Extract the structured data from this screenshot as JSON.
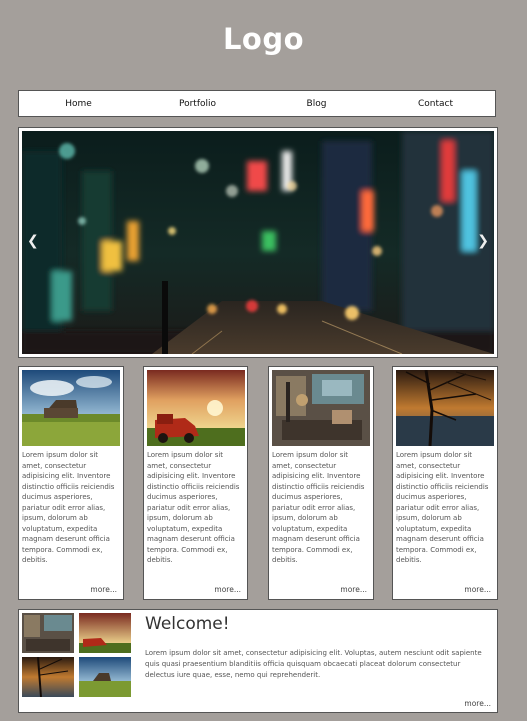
{
  "logo": "Logo",
  "nav": {
    "items": [
      "Home",
      "Portfolio",
      "Blog",
      "Contact"
    ]
  },
  "slider": {
    "prev_icon": "chevron-left-icon",
    "next_icon": "chevron-right-icon"
  },
  "cards": [
    {
      "text": "Lorem ipsum dolor sit amet, consectetur adipisicing elit. Inventore distinctio officiis reiciendis ducimus asperiores, pariatur odit error alias, ipsum, dolorum ab voluptatum, expedita magnam deserunt officia tempora. Commodi ex, debitis.",
      "more": "more..."
    },
    {
      "text": "Lorem ipsum dolor sit amet, consectetur adipisicing elit. Inventore distinctio officiis reiciendis ducimus asperiores, pariatur odit error alias, ipsum, dolorum ab voluptatum, expedita magnam deserunt officia tempora. Commodi ex, debitis.",
      "more": "more..."
    },
    {
      "text": "Lorem ipsum dolor sit amet, consectetur adipisicing elit. Inventore distinctio officiis reiciendis ducimus asperiores, pariatur odit error alias, ipsum, dolorum ab voluptatum, expedita magnam deserunt officia tempora. Commodi ex, debitis.",
      "more": "more..."
    },
    {
      "text": "Lorem ipsum dolor sit amet, consectetur adipisicing elit. Inventore distinctio officiis reiciendis ducimus asperiores, pariatur odit error alias, ipsum, dolorum ab voluptatum, expedita magnam deserunt officia tempora. Commodi ex, debitis.",
      "more": "more..."
    }
  ],
  "welcome": {
    "title": "Welcome!",
    "text": "Lorem ipsum dolor sit amet, consectetur adipisicing elit. Voluptas, autem nesciunt odit sapiente quis quasi praesentium blanditiis officia quisquam obcaecati placeat dolorum consectetur delectus iure quae, esse, nemo qui reprehenderit.",
    "more": "more..."
  },
  "colors": {
    "background": "#a49f9b",
    "panel": "#ffffff",
    "border": "#555555",
    "logo_text": "#ffffff"
  }
}
